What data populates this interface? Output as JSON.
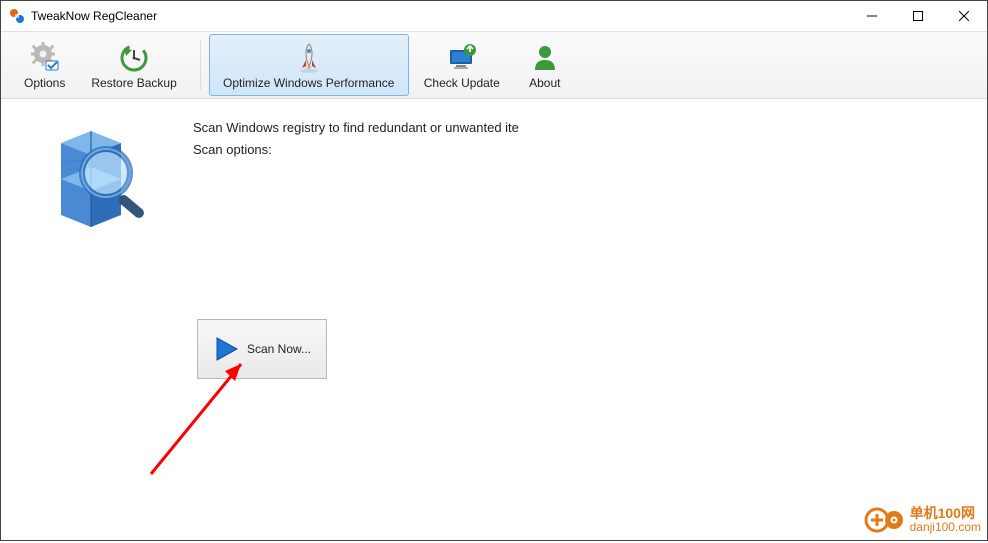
{
  "window": {
    "title": "TweakNow RegCleaner"
  },
  "toolbar": {
    "options_label": "Options",
    "restore_label": "Restore Backup",
    "optimize_label": "Optimize Windows Performance",
    "update_label": "Check Update",
    "about_label": "About"
  },
  "main": {
    "description_line1": "Scan Windows registry to find redundant or unwanted ite",
    "description_line2": "Scan options:",
    "scan_button_label": "Scan Now..."
  },
  "watermark": {
    "line1": "单机100网",
    "line2": "danji100.com"
  }
}
